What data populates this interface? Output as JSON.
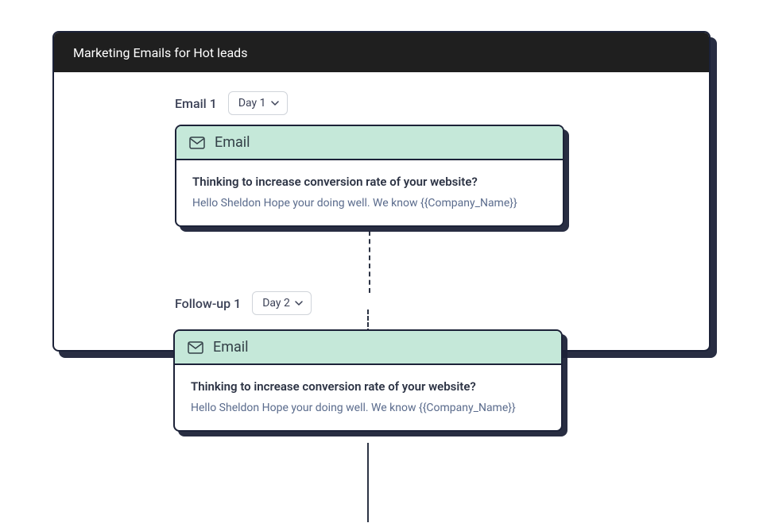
{
  "window": {
    "title": "Marketing Emails for Hot leads"
  },
  "steps": [
    {
      "label": "Email 1",
      "day_selector": "Day 1",
      "card": {
        "header_label": "Email",
        "subject": "Thinking to increase conversion rate of your website?",
        "preview": "Hello Sheldon Hope your doing well. We know {{Company_Name}}"
      }
    },
    {
      "label": "Follow-up 1",
      "day_selector": "Day 2",
      "card": {
        "header_label": "Email",
        "subject": "Thinking to increase conversion rate of your website?",
        "preview": "Hello Sheldon Hope your doing well. We know {{Company_Name}}"
      }
    }
  ]
}
